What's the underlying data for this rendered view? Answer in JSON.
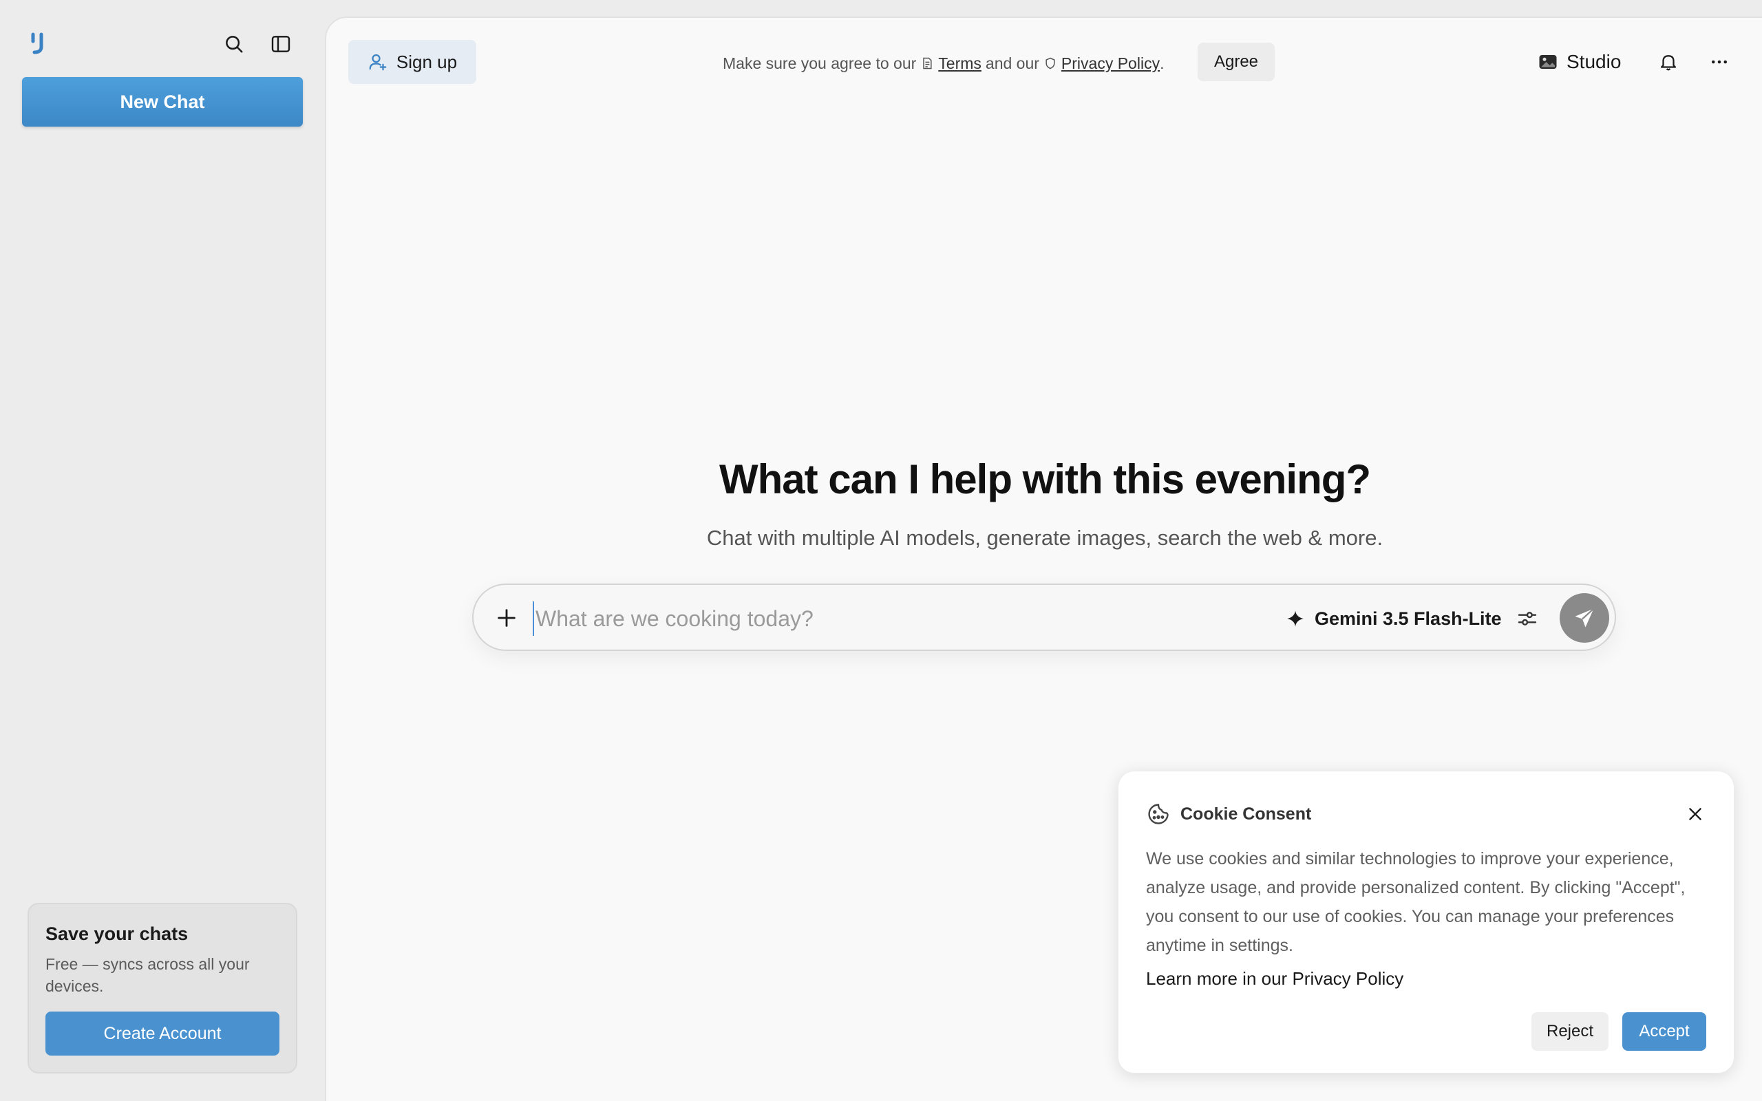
{
  "sidebar": {
    "new_chat_label": "New Chat",
    "save_card": {
      "title": "Save your chats",
      "description": "Free — syncs across all your devices.",
      "button_label": "Create Account"
    }
  },
  "header": {
    "signup_label": "Sign up",
    "notice_prefix": "Make sure you agree to our",
    "terms_label": "Terms",
    "notice_middle": "and our",
    "privacy_label": "Privacy Policy",
    "notice_suffix": ".",
    "agree_label": "Agree",
    "studio_label": "Studio"
  },
  "hero": {
    "title": "What can I help with this evening?",
    "subtitle": "Chat with multiple AI models, generate images, search the web & more."
  },
  "composer": {
    "placeholder": "What are we cooking today?",
    "model_label": "Gemini 3.5 Flash-Lite"
  },
  "cookie": {
    "title": "Cookie Consent",
    "body": "We use cookies and similar technologies to improve your experience, analyze usage, and provide personalized content. By clicking \"Accept\", you consent to our use of cookies. You can manage your preferences anytime in settings.",
    "link_label": "Learn more in our Privacy Policy",
    "reject_label": "Reject",
    "accept_label": "Accept"
  },
  "colors": {
    "accent": "#4a92cf",
    "sidebar_bg": "#ececec",
    "main_bg": "#f9f9f9",
    "send_button": "#8a8a8a"
  },
  "icons": {
    "logo": "logo-icon",
    "search": "search-icon",
    "sidebar_toggle": "sidebar-toggle-icon",
    "signup": "user-plus-icon",
    "terms": "document-icon",
    "privacy": "shield-icon",
    "studio": "image-icon",
    "notifications": "bell-icon",
    "more": "more-horizontal-icon",
    "attach": "plus-icon",
    "model": "sparkle-icon",
    "settings": "sliders-icon",
    "send": "send-icon",
    "cookie": "cookie-icon",
    "close": "close-icon"
  }
}
